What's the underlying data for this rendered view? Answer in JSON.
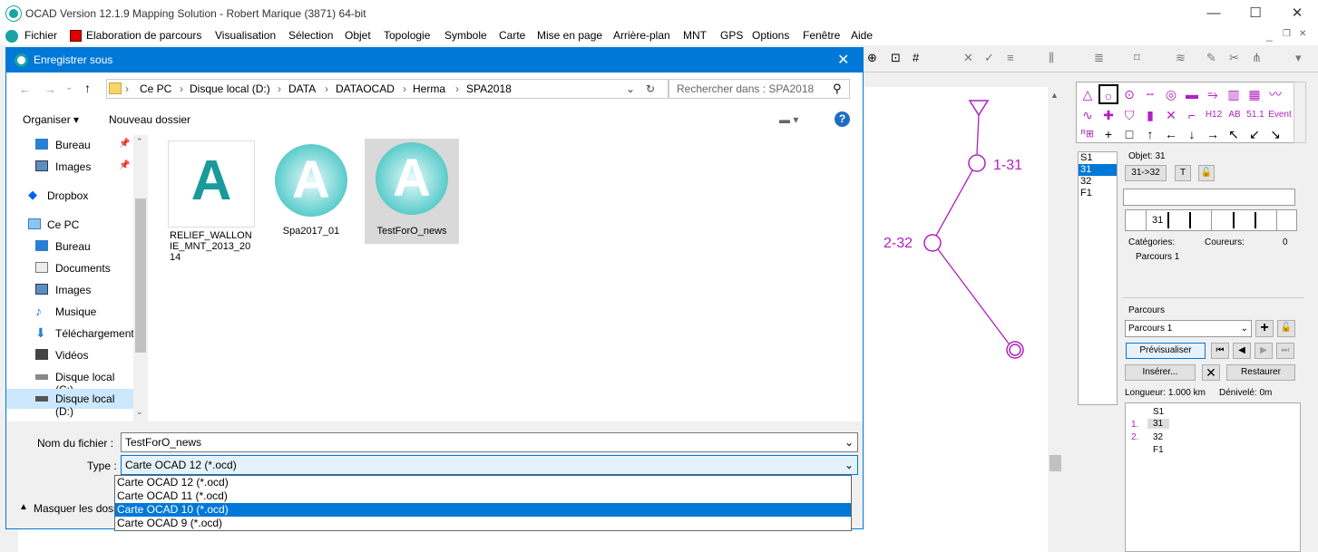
{
  "app": {
    "title": "OCAD Version 12.1.9  Mapping Solution - Robert Marique (3871) 64-bit",
    "minimize": "—",
    "maximize": "☐",
    "close": "✕"
  },
  "menu": [
    "Fichier",
    "Elaboration de parcours",
    "Visualisation",
    "Sélection",
    "Objet",
    "Topologie",
    "Symbole",
    "Carte",
    "Mise en page",
    "Arrière-plan",
    "MNT",
    "GPS",
    "Options",
    "Fenêtre",
    "Aide"
  ],
  "map": {
    "control1": "1-31",
    "control2": "2-32"
  },
  "right": {
    "codes": [
      "S1",
      "31",
      "32",
      "F1"
    ],
    "objet": "Objet: 31",
    "btn_3132": "31->32",
    "btn_t": "T",
    "code_cell": "31",
    "categories": "Catégories:",
    "coureurs": "Coureurs:",
    "coureurs_val": "0",
    "parcours_1": "Parcours 1",
    "parcours_label": "Parcours",
    "parcours_select": "Parcours 1",
    "previsualiser": "Prévisualiser",
    "inserer": "Insérer...",
    "restaurer": "Restaurer",
    "longueur": "Longueur: 1.000 km",
    "denivele": "Dénivelé: 0m",
    "list": [
      {
        "n": "",
        "c": "S1"
      },
      {
        "n": "1.",
        "c": "31"
      },
      {
        "n": "2.",
        "c": "32"
      },
      {
        "n": "",
        "c": "F1"
      }
    ],
    "sym_labels": [
      "H12",
      "AB",
      "51.1",
      "Event"
    ]
  },
  "dialog": {
    "title": "Enregistrer sous",
    "breadcrumb": [
      "Ce PC",
      "Disque local (D:)",
      "DATA",
      "DATAOCAD",
      "Herma",
      "SPA2018"
    ],
    "search_placeholder": "Rechercher dans : SPA2018",
    "organiser": "Organiser ▾",
    "nouveau": "Nouveau dossier",
    "nav": [
      "Bureau",
      "Images",
      "Dropbox",
      "Ce PC",
      "Bureau",
      "Documents",
      "Images",
      "Musique",
      "Téléchargement",
      "Vidéos",
      "Disque local (C:)",
      "Disque local (D:)"
    ],
    "files": [
      "RELIEF_WALLONIE_MNT_2013_2014",
      "Spa2017_01",
      "TestForO_news"
    ],
    "filename_label": "Nom du fichier :",
    "filename": "TestForO_news",
    "type_label": "Type :",
    "type": "Carte OCAD 12 (*.ocd)",
    "options": [
      "Carte OCAD 12 (*.ocd)",
      "Carte OCAD 11 (*.ocd)",
      "Carte OCAD 10 (*.ocd)",
      "Carte OCAD 9 (*.ocd)"
    ],
    "masquer": "Masquer les dossiers"
  }
}
